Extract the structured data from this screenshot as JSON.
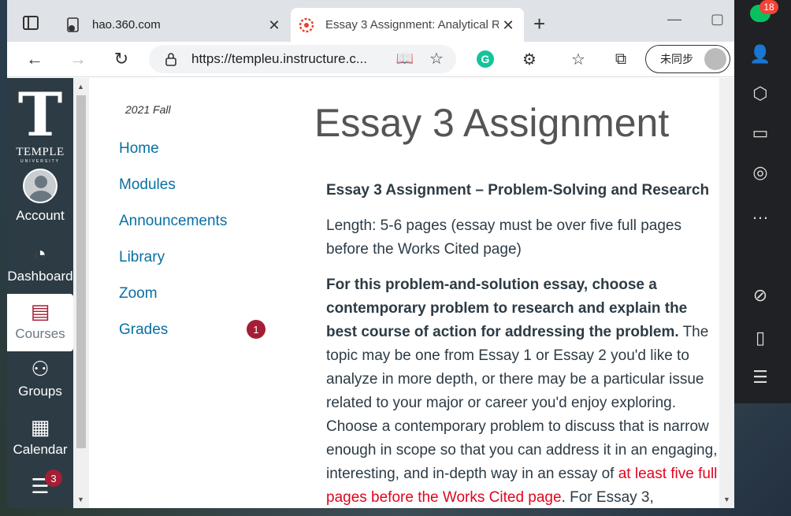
{
  "browser": {
    "tabs": [
      {
        "title": "hao.360.com",
        "active": false
      },
      {
        "title": "Essay 3 Assignment: Analytical Re",
        "active": true
      }
    ],
    "url": "https://templeu.instructure.c...",
    "sync_label": "未同步"
  },
  "global_nav": {
    "logo_name": "TEMPLE",
    "logo_sub": "UNIVERSITY",
    "items": [
      {
        "label": "Account"
      },
      {
        "label": "Dashboard"
      },
      {
        "label": "Courses"
      },
      {
        "label": "Groups"
      },
      {
        "label": "Calendar"
      }
    ],
    "inbox_badge": "3"
  },
  "course_nav": {
    "term": "2021 Fall",
    "links": [
      "Home",
      "Modules",
      "Announcements",
      "Library",
      "Zoom",
      "Grades"
    ],
    "grades_badge": "1"
  },
  "main": {
    "title": "Essay 3 Assignment",
    "heading": "Essay 3 Assignment – Problem-Solving and Research",
    "length": "Length: 5-6 pages (essay must be over five full pages before the Works Cited page)",
    "bold_intro": "For this problem-and-solution essay, choose a contemporary problem to research and explain the best course of action for addressing the problem.",
    "body": " The topic may be one from Essay 1 or Essay 2 you'd like to analyze in more depth, or there may be a particular issue related to your major or career you'd enjoy exploring. Choose a contemporary problem to discuss that is narrow enough in scope so that you can address it in an engaging, interesting, and in-depth way in an essay of ",
    "red_text": "at least five full pages before the Works Cited page",
    "tail": ". For Essay 3,"
  },
  "side_panel": {
    "chat_badge": "18"
  }
}
